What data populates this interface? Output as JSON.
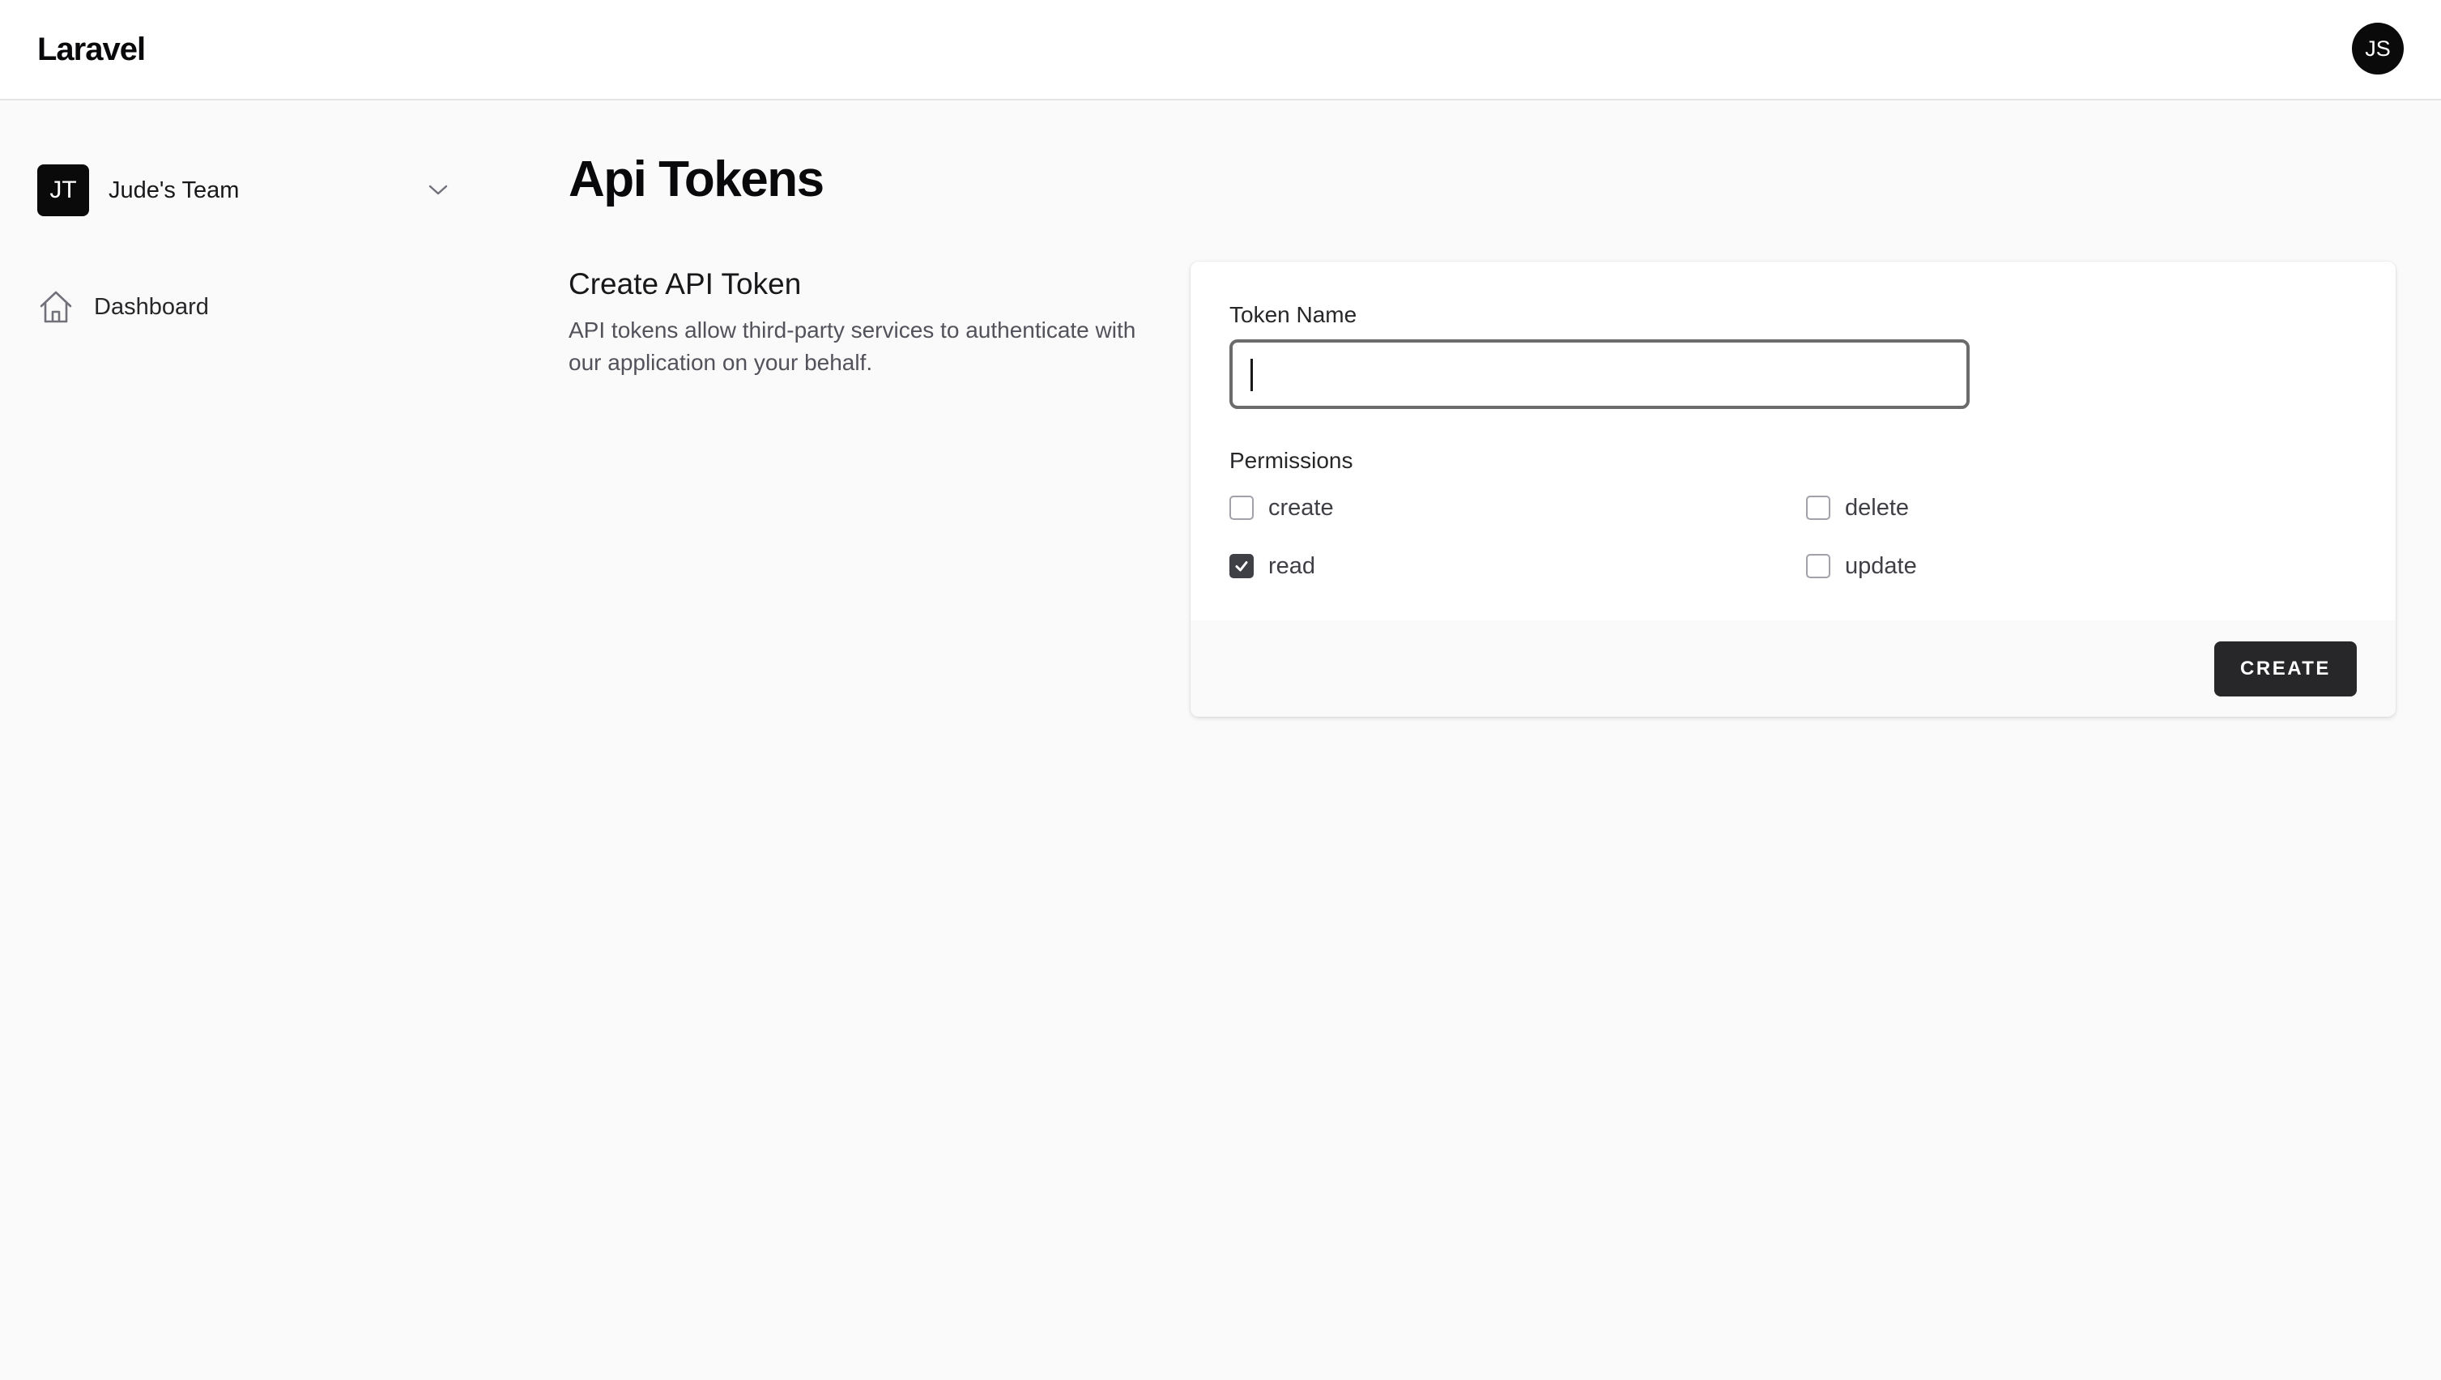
{
  "header": {
    "brand": "Laravel",
    "user_initials": "JS"
  },
  "sidebar": {
    "team": {
      "initials": "JT",
      "name": "Jude's Team",
      "chevron_icon": "chevron-down-icon"
    },
    "items": [
      {
        "label": "Dashboard",
        "icon": "home-icon"
      }
    ]
  },
  "main": {
    "title": "Api Tokens",
    "section": {
      "heading": "Create API Token",
      "description": "API tokens allow third-party services to authenticate with our application on your behalf."
    },
    "form": {
      "token_name_label": "Token Name",
      "token_name_value": "",
      "token_name_placeholder": "",
      "permissions_label": "Permissions",
      "permissions": [
        {
          "label": "create",
          "checked": false
        },
        {
          "label": "delete",
          "checked": false
        },
        {
          "label": "read",
          "checked": true
        },
        {
          "label": "update",
          "checked": false
        }
      ],
      "submit_label": "CREATE"
    }
  },
  "colors": {
    "background": "#fafafa",
    "surface": "#ffffff",
    "primary_button": "#27272a",
    "checkbox_checked": "#3f3f46",
    "avatar": "#0a0a0a"
  }
}
